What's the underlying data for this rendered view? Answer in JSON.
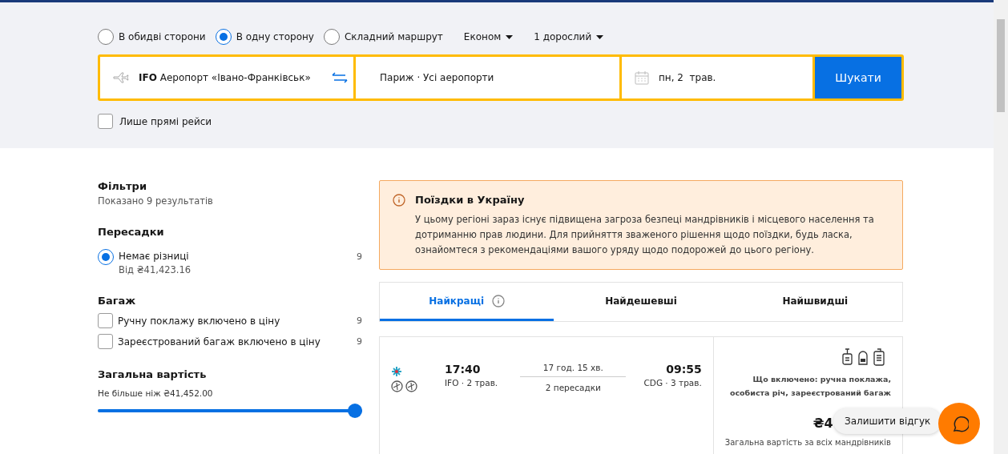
{
  "trip_types": [
    {
      "label": "В обидві сторони",
      "selected": false
    },
    {
      "label": "В одну сторону",
      "selected": true
    },
    {
      "label": "Складний маршрут",
      "selected": false
    }
  ],
  "cabin": {
    "label": "Економ"
  },
  "passengers": {
    "label": "1 дорослий"
  },
  "search": {
    "origin_code": "IFO",
    "origin_name": "Аеропорт «Івано-Франківськ»",
    "destination": "Париж · Усі аеропорти",
    "date": "пн, 2  трав.",
    "button": "Шукати"
  },
  "direct_only": {
    "label": "Лише прямі рейси",
    "checked": false
  },
  "filters": {
    "title": "Фільтри",
    "subtitle": "Показано 9 результатів",
    "stops": {
      "title": "Пересадки",
      "options": [
        {
          "label": "Немає різниці",
          "sub": "Від ₴41,423.16",
          "count": "9",
          "selected": true
        }
      ]
    },
    "baggage": {
      "title": "Багаж",
      "options": [
        {
          "label": "Ручну поклажу включено в ціну",
          "count": "9",
          "checked": false
        },
        {
          "label": "Зареєстрований багаж включено в ціну",
          "count": "9",
          "checked": false
        }
      ]
    },
    "price": {
      "title": "Загальна вартість",
      "caption": "Не більше ніж ₴41,452.00",
      "level": 1
    }
  },
  "alert": {
    "title": "Поїздки в Україну",
    "text": "У цьому регіоні зараз існує підвищена загроза безпеці мандрівників і місцевого населення та дотриманню прав людини. Для прийняття зваженого рішення щодо поїздки, будь ласка, ознайомтеся з рекомендаціями вашого уряду щодо подорожей до цього регіону."
  },
  "sort_tabs": [
    {
      "label": "Найкращі",
      "selected": true,
      "info": true
    },
    {
      "label": "Найдешевші",
      "selected": false,
      "info": false
    },
    {
      "label": "Найшвидші",
      "selected": false,
      "info": false
    }
  ],
  "flight": {
    "depart_time": "17:40",
    "depart_info": "IFO · 2 трав.",
    "duration": "17 год. 15 хв.",
    "stops": "2 пересадки",
    "arrive_time": "09:55",
    "arrive_info": "CDG · 3 трав.",
    "included": "Що включено: ручна поклажа, особиста річ, зареєстрований багаж",
    "price": "₴4",
    "price_note": "Загальна вартість за всіх мандрівників"
  },
  "feedback": {
    "label": "Залишити відгук"
  }
}
